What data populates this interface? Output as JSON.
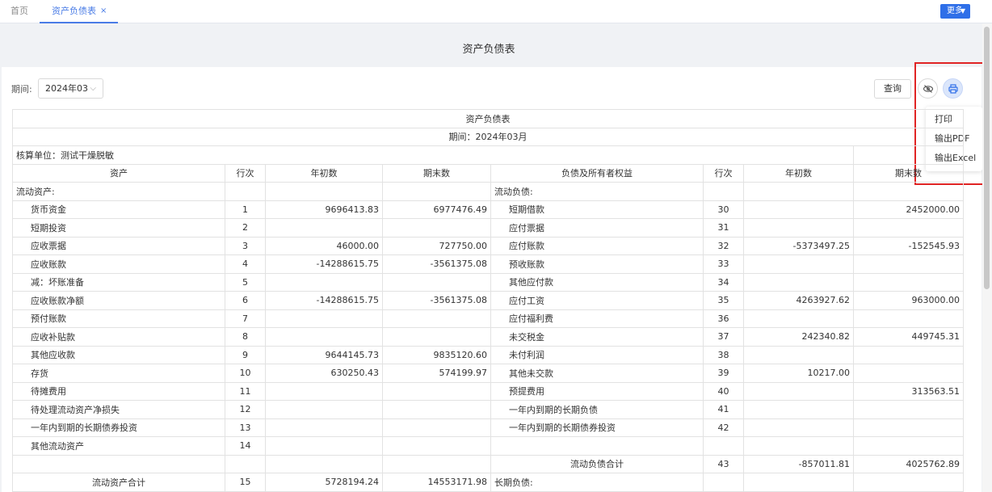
{
  "tabs": {
    "home": "首页",
    "active": "资产负债表",
    "close": "×"
  },
  "more_button": "更多",
  "page_title": "资产负债表",
  "filter": {
    "period_label": "期间:",
    "period_value": "2024年03",
    "query_button": "查询"
  },
  "dropdown": {
    "items": [
      "打印",
      "输出PDF",
      "输出Excel"
    ]
  },
  "report": {
    "title": "资产负债表",
    "period": "期间：2024年03月",
    "unit": "核算单位：测试干燥脱敏",
    "headers": [
      "资产",
      "行次",
      "年初数",
      "期末数",
      "负债及所有者权益",
      "行次",
      "年初数",
      "期末数"
    ],
    "rows": [
      [
        "流动资产:",
        "",
        "",
        "",
        "流动负债:",
        "",
        "",
        ""
      ],
      [
        "货币资金",
        "1",
        "9696413.83",
        "6977476.49",
        "短期借款",
        "30",
        "",
        "2452000.00"
      ],
      [
        "短期投资",
        "2",
        "",
        "",
        "应付票据",
        "31",
        "",
        ""
      ],
      [
        "应收票据",
        "3",
        "46000.00",
        "727750.00",
        "应付账款",
        "32",
        "-5373497.25",
        "-152545.93"
      ],
      [
        "应收账款",
        "4",
        "-14288615.75",
        "-3561375.08",
        "预收账款",
        "33",
        "",
        ""
      ],
      [
        "减：坏账准备",
        "5",
        "",
        "",
        "其他应付款",
        "34",
        "",
        ""
      ],
      [
        "应收账款净额",
        "6",
        "-14288615.75",
        "-3561375.08",
        "应付工资",
        "35",
        "4263927.62",
        "963000.00"
      ],
      [
        "预付账款",
        "7",
        "",
        "",
        "应付福利费",
        "36",
        "",
        ""
      ],
      [
        "应收补贴款",
        "8",
        "",
        "",
        "未交税金",
        "37",
        "242340.82",
        "449745.31"
      ],
      [
        "其他应收款",
        "9",
        "9644145.73",
        "9835120.60",
        "未付利润",
        "38",
        "",
        ""
      ],
      [
        "存货",
        "10",
        "630250.43",
        "574199.97",
        "其他未交款",
        "39",
        "10217.00",
        ""
      ],
      [
        "待摊费用",
        "11",
        "",
        "",
        "预提费用",
        "40",
        "",
        "313563.51"
      ],
      [
        "待处理流动资产净损失",
        "12",
        "",
        "",
        "一年内到期的长期负债",
        "41",
        "",
        ""
      ],
      [
        "一年内到期的长期债券投资",
        "13",
        "",
        "",
        "一年内到期的长期债券投资",
        "42",
        "",
        ""
      ],
      [
        "其他流动资产",
        "14",
        "",
        "",
        "",
        "",
        "",
        ""
      ],
      [
        "",
        "",
        "",
        "",
        "流动负债合计",
        "43",
        "-857011.81",
        "4025762.89"
      ],
      [
        "流动资产合计",
        "15",
        "5728194.24",
        "14553171.98",
        "长期负债:",
        "",
        "",
        ""
      ]
    ]
  }
}
